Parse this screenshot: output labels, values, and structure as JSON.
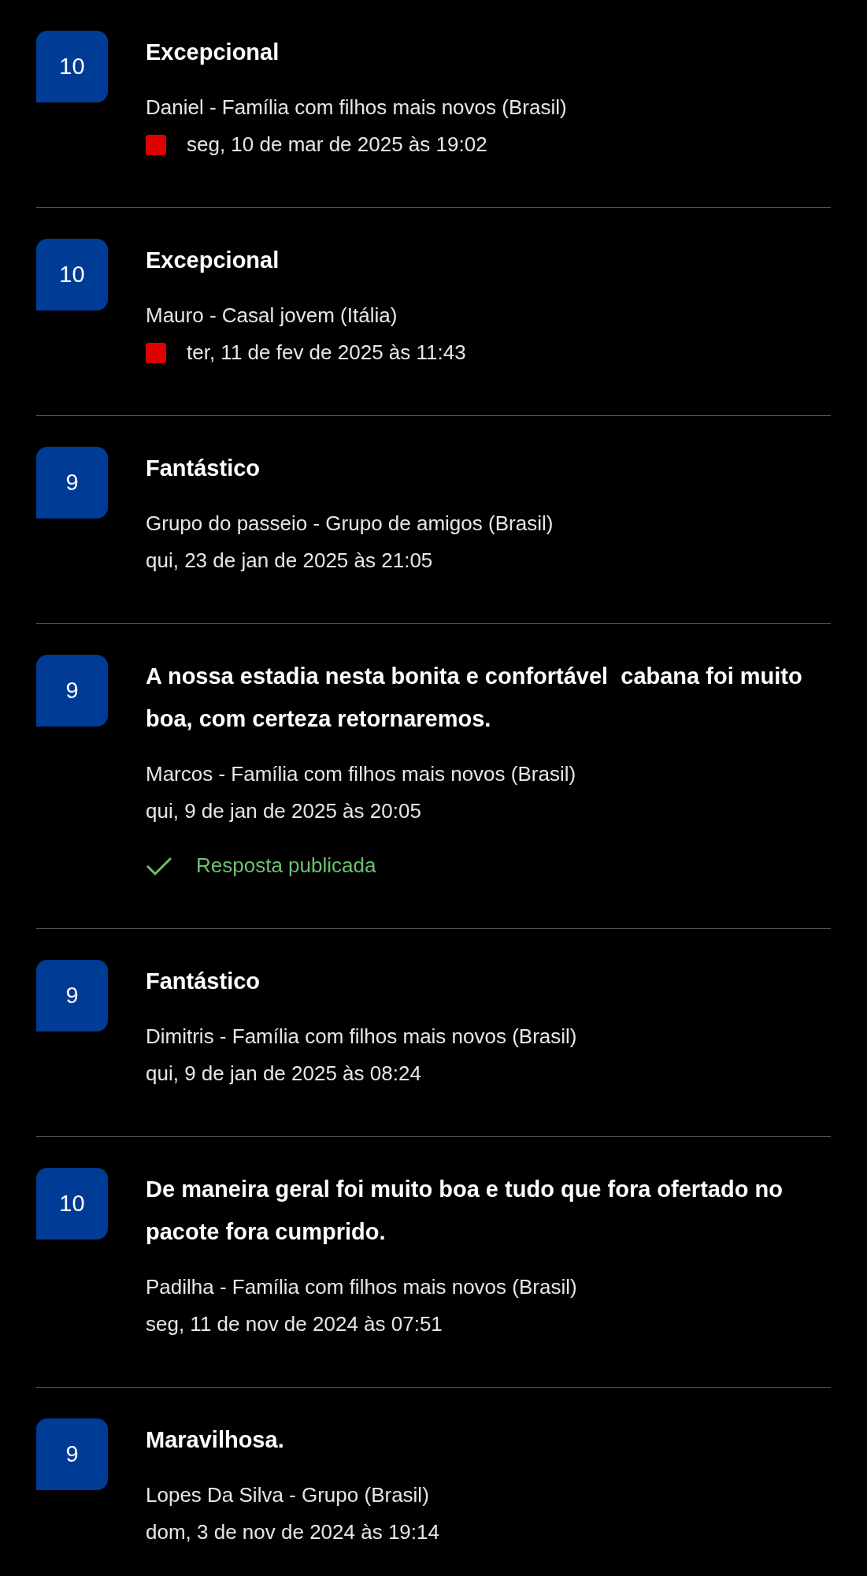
{
  "reviews": [
    {
      "score": "10",
      "title": "Excepcional",
      "author": "Daniel - Família com filhos mais novos (Brasil)",
      "flagged": true,
      "date": "seg, 10 de mar de 2025 às 19:02"
    },
    {
      "score": "10",
      "title": "Excepcional",
      "author": "Mauro - Casal jovem (Itália)",
      "flagged": true,
      "date": "ter, 11 de fev de 2025 às 11:43"
    },
    {
      "score": "9",
      "title": "Fantástico",
      "author": "Grupo do passeio - Grupo de amigos (Brasil)",
      "flagged": false,
      "date": "qui, 23 de jan de 2025 às 21:05"
    },
    {
      "score": "9",
      "title": "A nossa estadia nesta bonita e confortável  cabana foi muito boa, com certeza retornaremos.",
      "author": "Marcos - Família com filhos mais novos (Brasil)",
      "flagged": false,
      "date": "qui, 9 de jan de 2025 às 20:05",
      "reply": "Resposta publicada"
    },
    {
      "score": "9",
      "title": "Fantástico",
      "author": "Dimitris - Família com filhos mais novos (Brasil)",
      "flagged": false,
      "date": "qui, 9 de jan de 2025 às 08:24"
    },
    {
      "score": "10",
      "title": "De maneira geral foi muito boa e tudo que fora ofertado no pacote fora cumprido.",
      "author": "Padilha - Família com filhos mais novos (Brasil)",
      "flagged": false,
      "date": "seg, 11 de nov de 2024 às 07:51"
    },
    {
      "score": "9",
      "title": "Maravilhosa.",
      "author": "Lopes Da Silva - Grupo (Brasil)",
      "flagged": false,
      "date": "dom, 3 de nov de 2024 às 19:14"
    }
  ]
}
